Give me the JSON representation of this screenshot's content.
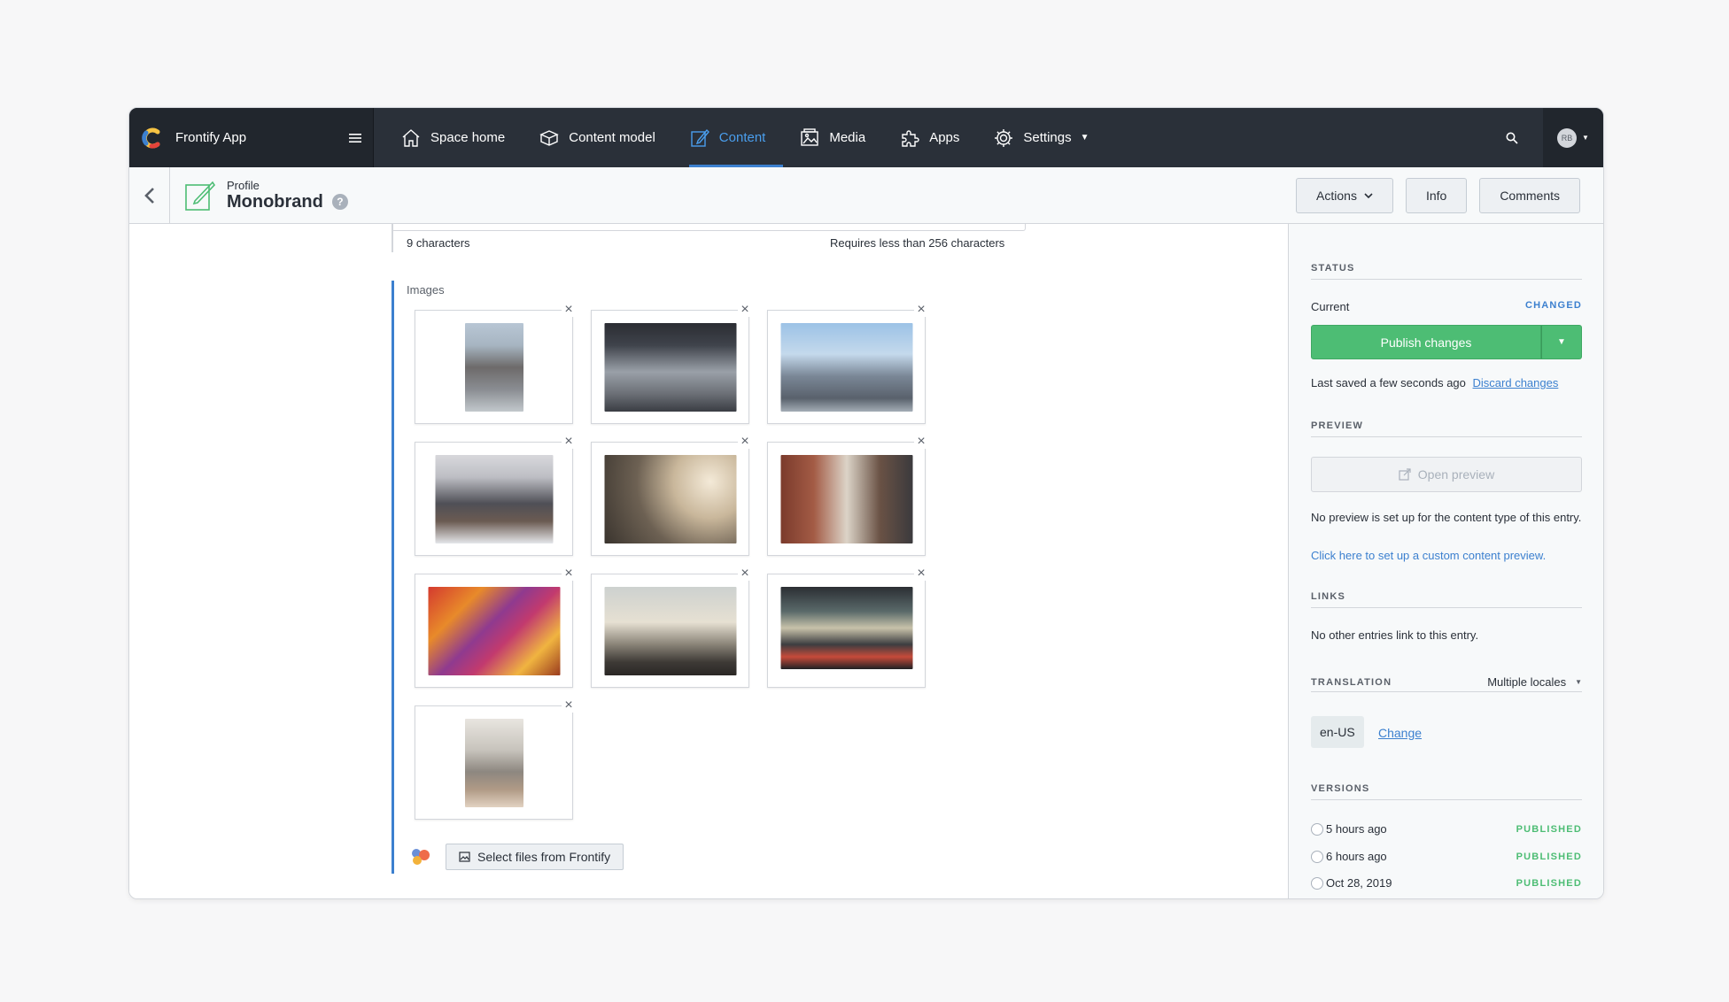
{
  "app": {
    "name": "Frontify App"
  },
  "nav": {
    "items": [
      {
        "label": "Space home",
        "icon": "home-icon"
      },
      {
        "label": "Content model",
        "icon": "box-icon"
      },
      {
        "label": "Content",
        "icon": "edit-icon",
        "active": true
      },
      {
        "label": "Media",
        "icon": "image-icon"
      },
      {
        "label": "Apps",
        "icon": "puzzle-icon"
      },
      {
        "label": "Settings",
        "icon": "gear-icon"
      }
    ],
    "account_initials": "RB"
  },
  "entry": {
    "type": "Profile",
    "title": "Monobrand",
    "help": "?"
  },
  "actions": {
    "actions_label": "Actions",
    "info_label": "Info",
    "comments_label": "Comments"
  },
  "field": {
    "char_count": "9 characters",
    "char_limit": "Requires less than 256 characters"
  },
  "images": {
    "label": "Images",
    "close": "×",
    "select_label": "Select files from Frontify",
    "thumbnails": [
      "street-bridge-photo",
      "elevated-train-street-photo",
      "woman-city-skyline-photo",
      "city-skyline-pier-photo",
      "bubbles-bokeh-photo",
      "woman-street-photo",
      "autumn-leaves-photo",
      "skyscraper-city-photo",
      "highway-light-trails-photo",
      "man-walking-city-photo"
    ]
  },
  "sidebar": {
    "status": {
      "heading": "STATUS",
      "current_label": "Current",
      "current_value": "CHANGED",
      "publish_label": "Publish changes",
      "last_saved": "Last saved a few seconds ago",
      "discard_label": "Discard changes"
    },
    "preview": {
      "heading": "PREVIEW",
      "open_label": "Open preview",
      "note": "No preview is set up for the content type of this entry.",
      "setup_link": "Click here to set up a custom content preview."
    },
    "links": {
      "heading": "LINKS",
      "note": "No other entries link to this entry."
    },
    "translation": {
      "heading": "TRANSLATION",
      "mode": "Multiple locales",
      "locale": "en-US",
      "change_label": "Change"
    },
    "versions": {
      "heading": "VERSIONS",
      "items": [
        {
          "time": "5 hours ago",
          "status": "PUBLISHED"
        },
        {
          "time": "6 hours ago",
          "status": "PUBLISHED"
        },
        {
          "time": "Oct 28, 2019",
          "status": "PUBLISHED"
        }
      ]
    }
  },
  "colors": {
    "nav_bg": "#2a3039",
    "accent": "#3c80cf",
    "publish": "#4dbd74"
  }
}
